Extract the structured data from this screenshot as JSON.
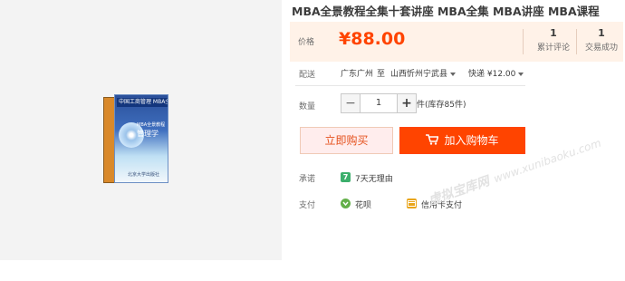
{
  "product": {
    "title": "MBA全景教程全集十套讲座 MBA全集 MBA讲座 MBA课程",
    "image": {
      "badge": "中国工商管理 MBA全景教程",
      "cover_title": "管理学",
      "cover_subtitle": "MBA全景教程",
      "publisher": "北京大学出版社"
    }
  },
  "price_panel": {
    "label": "价格",
    "price": "¥88.00",
    "stats": [
      {
        "count": "1",
        "label": "累计评论"
      },
      {
        "count": "1",
        "label": "交易成功"
      }
    ]
  },
  "shipping": {
    "label": "配送",
    "from": "广东广州",
    "to_word": "至",
    "destination": "山西忻州宁武县",
    "method": "快递 ¥12.00"
  },
  "quantity": {
    "label": "数量",
    "minus": "−",
    "value": "1",
    "plus": "+",
    "stock": "件(库存85件)"
  },
  "actions": {
    "buy_now": "立即购买",
    "add_to_cart": "加入购物车"
  },
  "promise": {
    "label": "承诺",
    "chip": "7",
    "text": "7天无理由"
  },
  "payment": {
    "label": "支付",
    "huabei": "花呗",
    "card": "信用卡支付"
  },
  "watermark": {
    "cn": "虚拟宝库网",
    "url": "www.xunibaoku.com"
  },
  "colors": {
    "accent": "#ff4400",
    "price": "#ff4400",
    "price_panel_bg": "#fff2e8"
  },
  "icons": [
    "cart-icon",
    "caret-down-icon",
    "check-chip-icon",
    "huabei-icon",
    "credit-card-icon"
  ]
}
